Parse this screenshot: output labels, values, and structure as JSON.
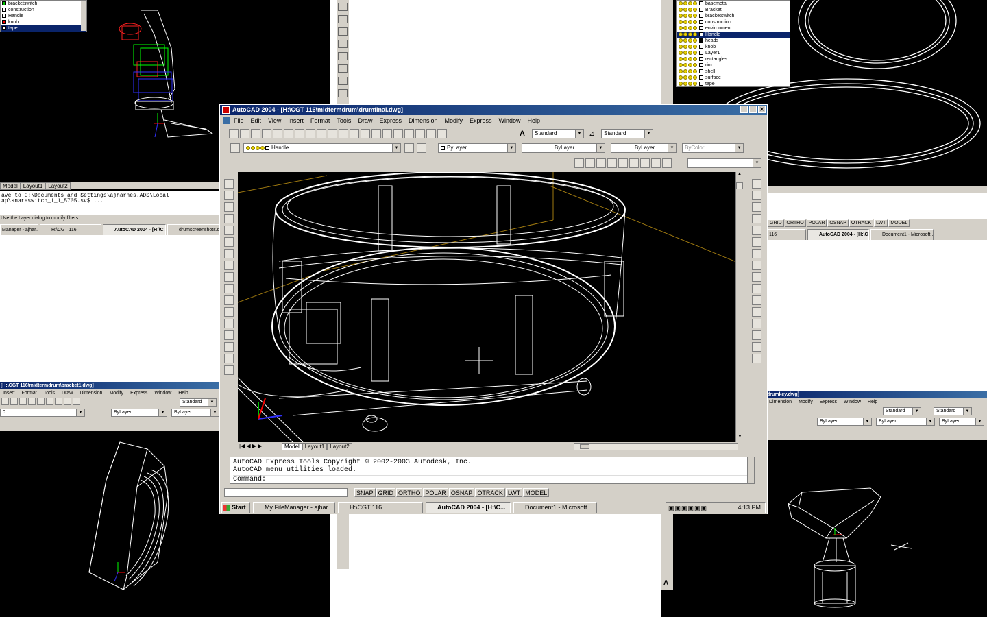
{
  "bg_topleft_layers": {
    "items": [
      {
        "name": "bracketswitch",
        "color": "#00c000"
      },
      {
        "name": "construction",
        "color": "#ffffff"
      },
      {
        "name": "Handle",
        "color": "#ffffff"
      },
      {
        "name": "knob",
        "color": "#ff0000"
      },
      {
        "name": "tape",
        "color": "#ffffff",
        "selected": true
      }
    ]
  },
  "bg_left": {
    "tabs": [
      "Model",
      "Layout1",
      "Layout2"
    ],
    "cmd_lines": [
      "ave to C:\\Documents and Settings\\ajharnes.ADS\\Local",
      "ap\\snareswitch_1_1_5705.sv$ ..."
    ],
    "status": "Use the Layer dialog to modify filters.",
    "tasks": [
      "Manager - ajhar...",
      "H:\\CGT 116",
      "AutoCAD 2004 - [H:\\C...",
      "drumscreenshots.doc -..."
    ],
    "title": "[H:\\CGT 116\\midtermdrum\\bracket1.dwg]",
    "menu": [
      "Insert",
      "Format",
      "Tools",
      "Draw",
      "Dimension",
      "Modify",
      "Express",
      "Window",
      "Help"
    ],
    "style": "Standard",
    "layer": "0",
    "color": "ByLayer",
    "linetype": "ByLayer"
  },
  "bg_right_layers": {
    "items": [
      {
        "name": "basemetal",
        "color": "#ffffff"
      },
      {
        "name": "Bracket",
        "color": "#ffffff"
      },
      {
        "name": "bracketswitch",
        "color": "#ffffff"
      },
      {
        "name": "construction",
        "color": "#ffffff"
      },
      {
        "name": "environment",
        "color": "#ffffff"
      },
      {
        "name": "Handle",
        "color": "#ffffff",
        "selected": true
      },
      {
        "name": "heads",
        "color": "#000000"
      },
      {
        "name": "knob",
        "color": "#ffffff"
      },
      {
        "name": "Layer1",
        "color": "#ffffff"
      },
      {
        "name": "rectangles",
        "color": "#ffffff"
      },
      {
        "name": "rim",
        "color": "#ffffff"
      },
      {
        "name": "shell",
        "color": "#ffffff"
      },
      {
        "name": "surface",
        "color": "#ffffff"
      },
      {
        "name": "tape",
        "color": "#ffffff"
      }
    ]
  },
  "bg_right": {
    "status_buttons": [
      "GRID",
      "ORTHO",
      "POLAR",
      "OSNAP",
      "OTRACK",
      "LWT",
      "MODEL"
    ],
    "tasks": [
      "116",
      "AutoCAD 2004 - [H:\\C...",
      "Document1 - Microsoft ..."
    ],
    "title": "drumkey.dwg]",
    "menu": [
      "Dimension",
      "Modify",
      "Express",
      "Window",
      "Help"
    ],
    "style1": "Standard",
    "style2": "Standard",
    "color": "ByLayer",
    "linetype1": "ByLayer",
    "linetype2": "ByLayer"
  },
  "main": {
    "title": "AutoCAD 2004 - [H:\\CGT 116\\midtermdrum\\drumfinal.dwg]",
    "menu": [
      "File",
      "Edit",
      "View",
      "Insert",
      "Format",
      "Tools",
      "Draw",
      "Express",
      "Dimension",
      "Modify",
      "Express",
      "Window",
      "Help"
    ],
    "text_style": "Standard",
    "dim_style": "Standard",
    "layer": "Handle",
    "color": "ByLayer",
    "linetype": "ByLayer",
    "lineweight": "ByLayer",
    "plotstyle": "ByColor",
    "tabs": [
      "Model",
      "Layout1",
      "Layout2"
    ],
    "command_lines": [
      "AutoCAD Express Tools Copyright © 2002-2003 Autodesk, Inc.",
      "AutoCAD menu utilities loaded."
    ],
    "command_prompt": "Command:",
    "status_buttons": [
      "SNAP",
      "GRID",
      "ORTHO",
      "POLAR",
      "OSNAP",
      "OTRACK",
      "LWT",
      "MODEL"
    ],
    "taskbar": {
      "start": "Start",
      "tasks": [
        "My FileManager - ajhar...",
        "H:\\CGT 116",
        "AutoCAD 2004 - [H:\\C...",
        "Document1 - Microsoft ..."
      ],
      "time": "4:13 PM"
    }
  },
  "colors": {
    "selection": "#0a246a",
    "titlebar": "#0a246a",
    "chrome": "#d4d0c8",
    "canvas": "#000000",
    "axis_x": "#0000ff",
    "axis_y": "#00c000",
    "axis_z": "#ff0000",
    "construction_line": "#a07a10"
  }
}
